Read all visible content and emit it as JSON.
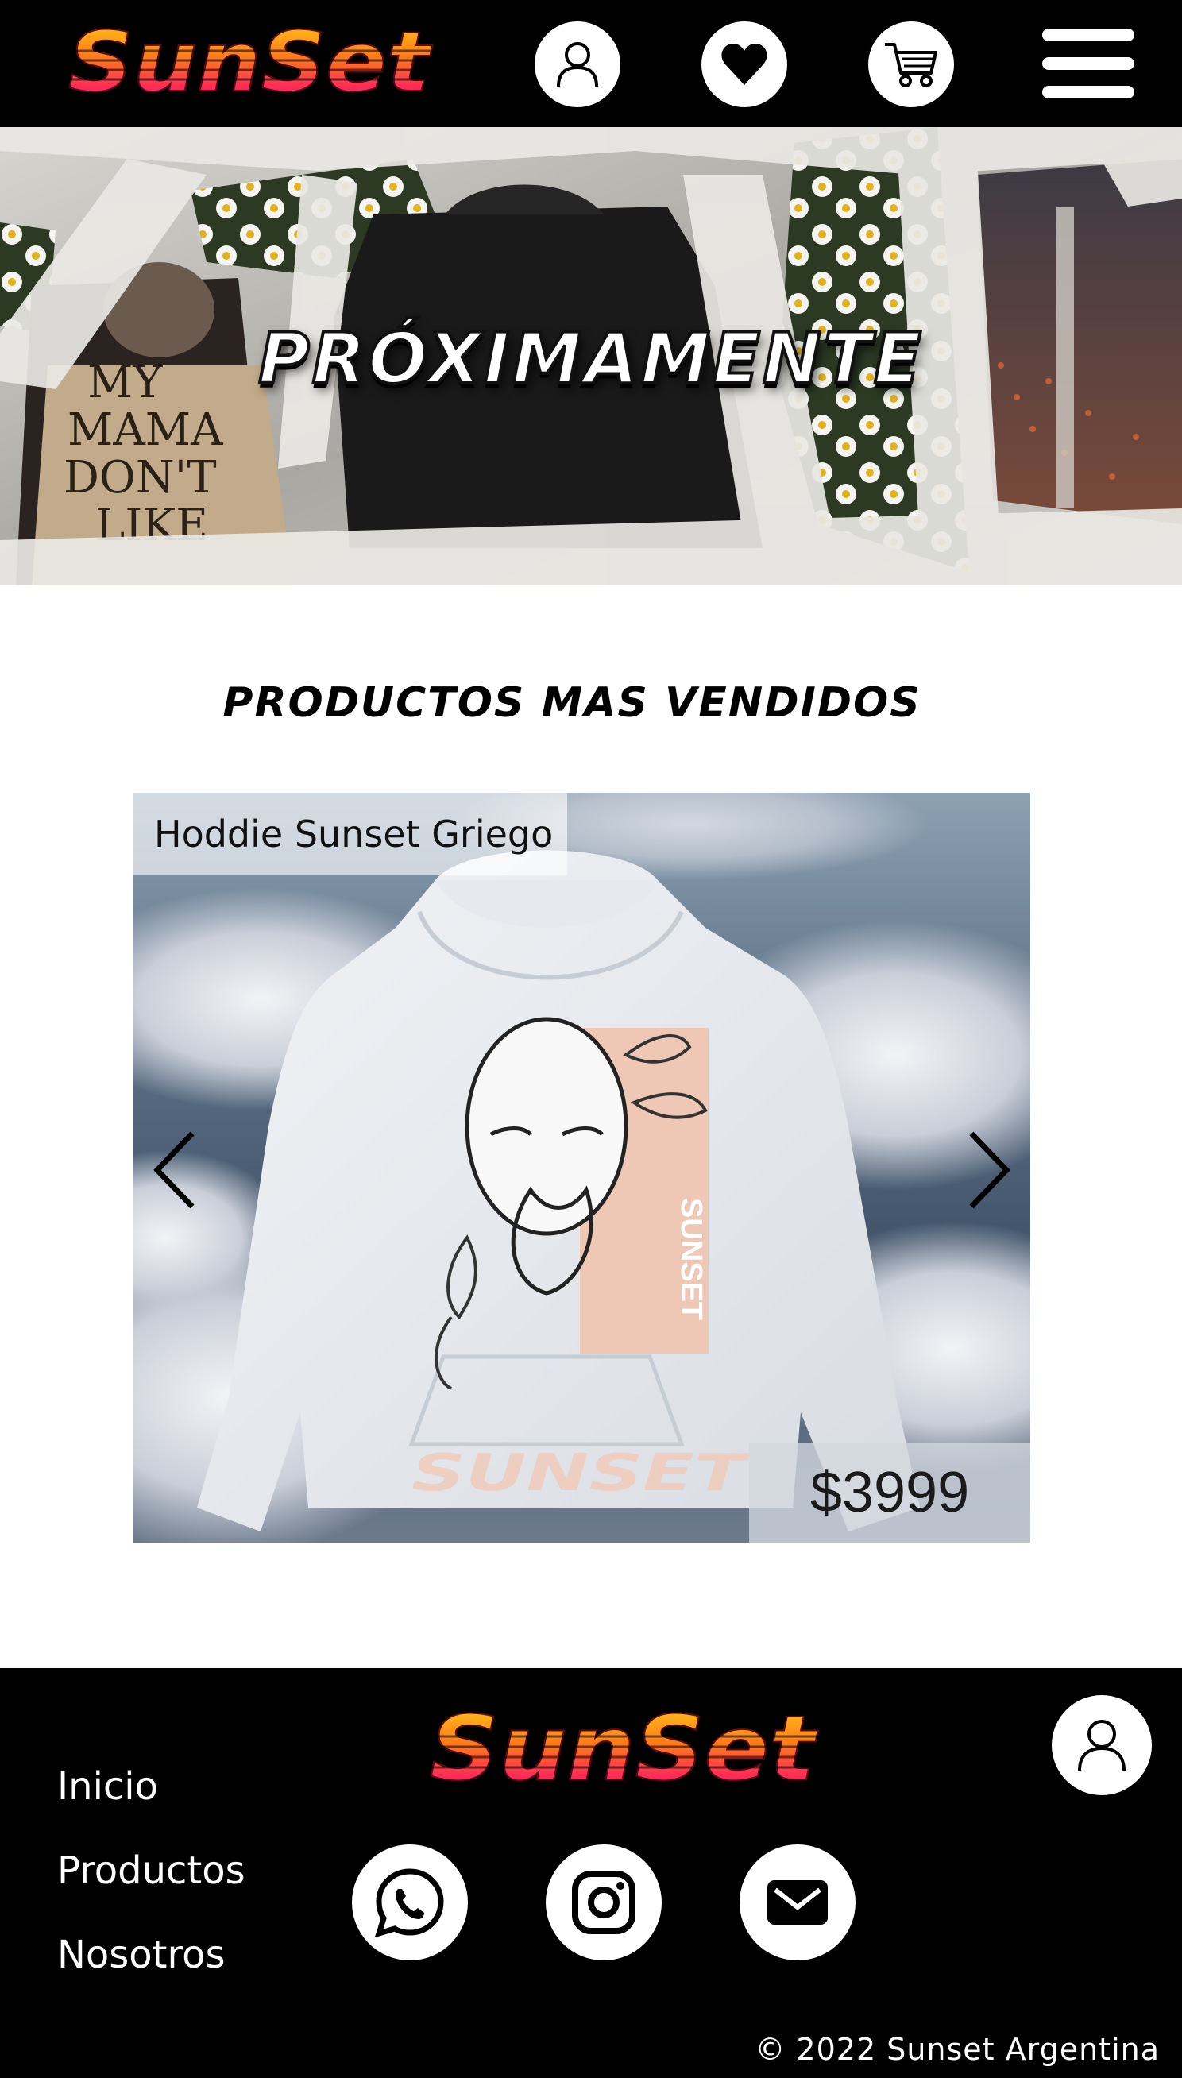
{
  "header": {
    "logo_text": "SunSet",
    "icons": [
      "user-icon",
      "heart-icon",
      "cart-icon",
      "hamburger-menu-icon"
    ]
  },
  "hero": {
    "title": "PRÓXIMAMENTE",
    "shirt_text": [
      "MY",
      "MAMA",
      "DON'T",
      "LIKE"
    ]
  },
  "bestsellers": {
    "title": "PRODUCTOS MAS VENDIDOS",
    "product": {
      "name": "Hoddie Sunset Griego",
      "price": "$3999",
      "print_text": "SUNSET",
      "hem_text": "SUNSET"
    },
    "prev_icon": "chevron-left-icon",
    "next_icon": "chevron-right-icon"
  },
  "footer": {
    "logo_text": "SunSet",
    "nav": [
      "Inicio",
      "Productos",
      "Nosotros"
    ],
    "social_icons": [
      "whatsapp-icon",
      "instagram-icon",
      "mail-icon"
    ],
    "copyright": "© 2022 Sunset Argentina"
  },
  "colors": {
    "logo_gradient": [
      "#ffd21a",
      "#ff7a1a",
      "#ff2d55",
      "#c2186a"
    ],
    "header_bg": "#000000",
    "footer_bg": "#000000"
  }
}
